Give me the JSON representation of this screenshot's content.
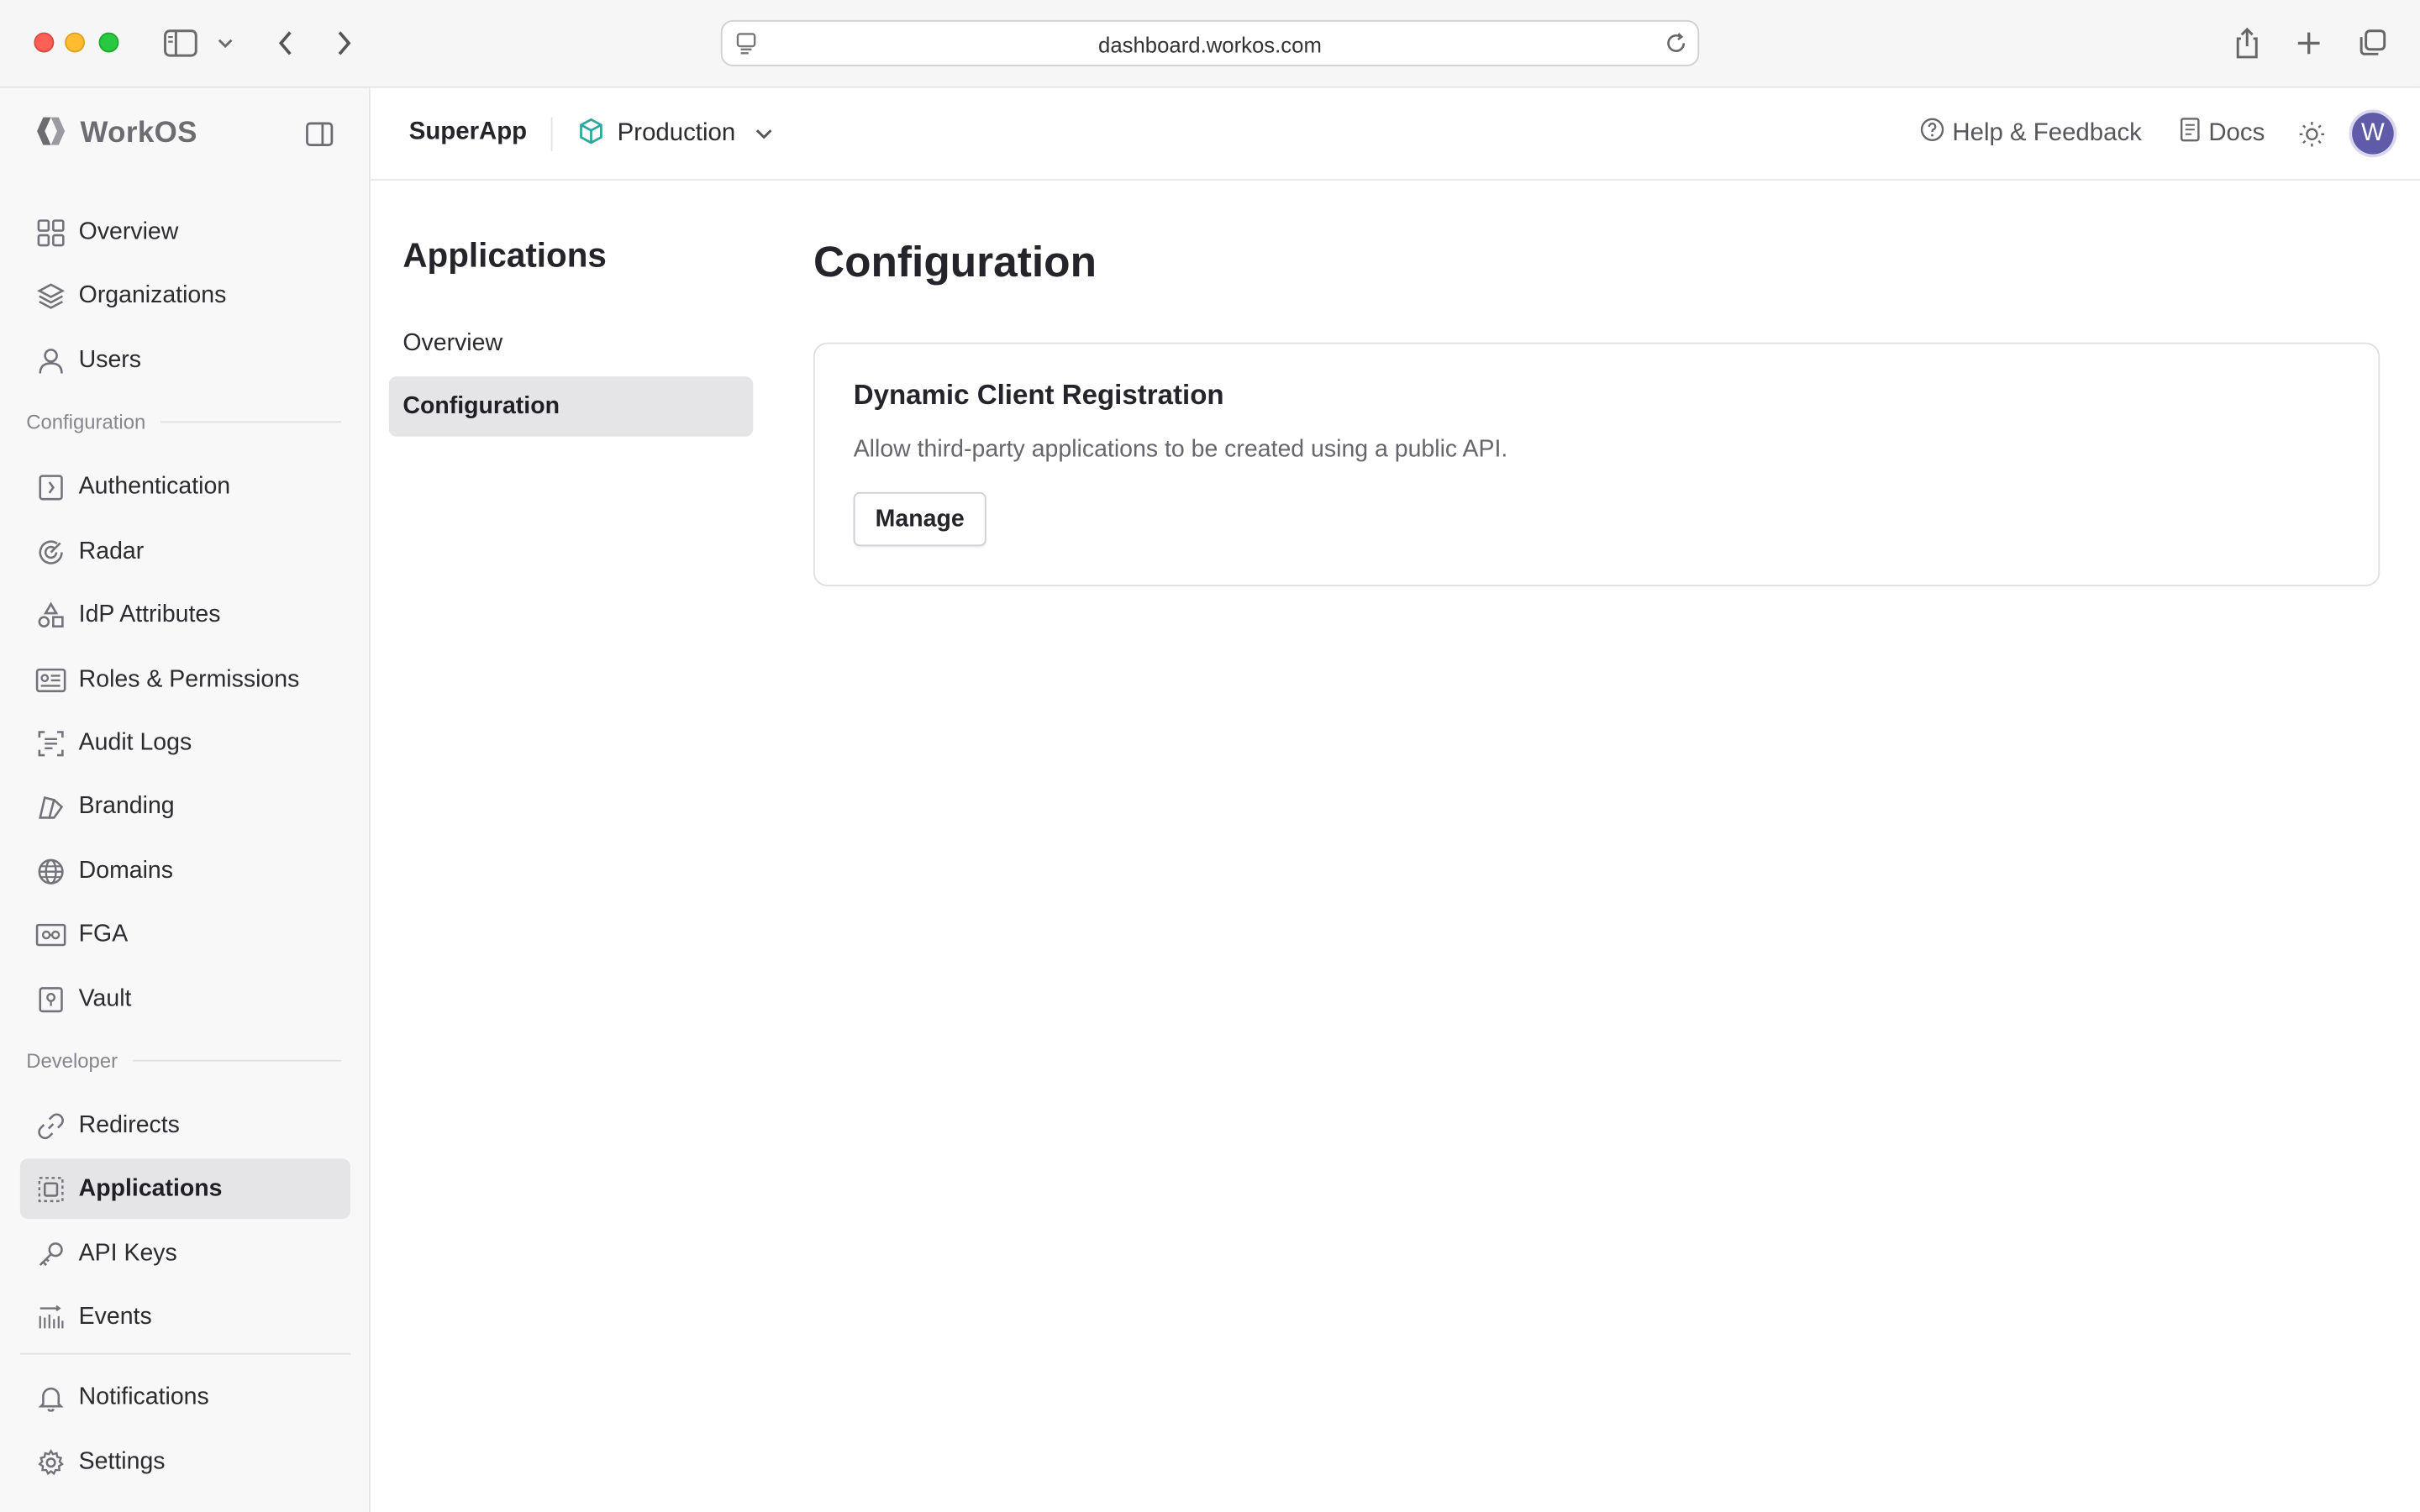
{
  "browser": {
    "url": "dashboard.workos.com",
    "icons": [
      "sidebar-toggle-icon",
      "chevron-down-icon",
      "back-icon",
      "forward-icon",
      "page-settings-icon",
      "reload-icon",
      "share-icon",
      "new-tab-icon",
      "tab-overview-icon"
    ]
  },
  "brand": {
    "name": "WorkOS"
  },
  "sidebar": {
    "primary": [
      {
        "label": "Overview",
        "icon": "grid-icon"
      },
      {
        "label": "Organizations",
        "icon": "layers-icon"
      },
      {
        "label": "Users",
        "icon": "user-icon"
      }
    ],
    "configuration_label": "Configuration",
    "configuration": [
      {
        "label": "Authentication",
        "icon": "auth-icon"
      },
      {
        "label": "Radar",
        "icon": "radar-icon"
      },
      {
        "label": "IdP Attributes",
        "icon": "shapes-icon"
      },
      {
        "label": "Roles & Permissions",
        "icon": "id-card-icon"
      },
      {
        "label": "Audit Logs",
        "icon": "audit-icon"
      },
      {
        "label": "Branding",
        "icon": "brush-icon"
      },
      {
        "label": "Domains",
        "icon": "globe-icon"
      },
      {
        "label": "FGA",
        "icon": "fga-icon"
      },
      {
        "label": "Vault",
        "icon": "vault-icon"
      }
    ],
    "developer_label": "Developer",
    "developer": [
      {
        "label": "Redirects",
        "icon": "link-icon"
      },
      {
        "label": "Applications",
        "icon": "applications-icon",
        "active": true
      },
      {
        "label": "API Keys",
        "icon": "key-icon"
      },
      {
        "label": "Events",
        "icon": "events-icon"
      }
    ],
    "bottom": [
      {
        "label": "Notifications",
        "icon": "bell-icon"
      },
      {
        "label": "Settings",
        "icon": "gear-icon"
      }
    ]
  },
  "topbar": {
    "app_name": "SuperApp",
    "environment": "Production",
    "help_label": "Help & Feedback",
    "docs_label": "Docs",
    "avatar_initial": "W"
  },
  "subnav": {
    "title": "Applications",
    "items": [
      {
        "label": "Overview"
      },
      {
        "label": "Configuration",
        "active": true
      }
    ]
  },
  "main": {
    "title": "Configuration",
    "card": {
      "title": "Dynamic Client Registration",
      "description": "Allow third-party applications to be created using a public API.",
      "button_label": "Manage"
    }
  },
  "colors": {
    "accent_env": "#2fa6a0",
    "avatar": "#5f5ba8",
    "active_bg": "#e5e5e8"
  }
}
